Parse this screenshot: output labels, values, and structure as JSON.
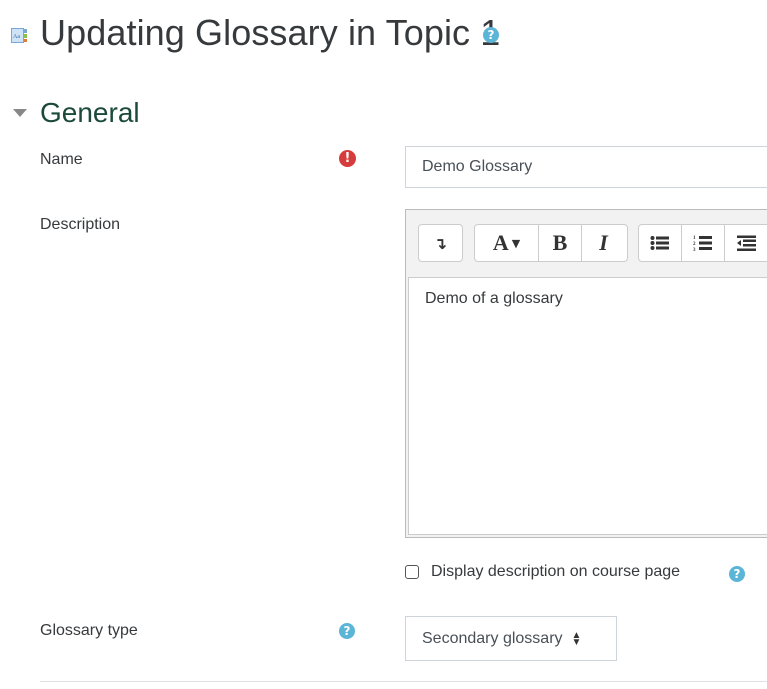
{
  "header": {
    "icon": "glossary-icon",
    "title": "Updating Glossary in Topic 1",
    "help_icon": "help-question-icon"
  },
  "section": {
    "caret_icon": "caret-down-icon",
    "title": "General"
  },
  "form": {
    "name": {
      "label": "Name",
      "required_icon": "exclamation-circle-icon",
      "value": "Demo Glossary"
    },
    "description": {
      "label": "Description",
      "toolbar": [
        {
          "name": "toolbar-toggle",
          "glyph": "↴"
        },
        {
          "name": "font-style",
          "glyph": "A▾"
        },
        {
          "name": "bold",
          "glyph": "B"
        },
        {
          "name": "italic",
          "glyph": "I"
        },
        {
          "name": "unordered-list",
          "glyph": "☰"
        },
        {
          "name": "ordered-list",
          "glyph": "☰"
        },
        {
          "name": "outdent",
          "glyph": "☰"
        }
      ],
      "content": "Demo of a glossary"
    },
    "display_description": {
      "label": "Display description on course page",
      "checked": false
    },
    "glossary_type": {
      "label": "Glossary type",
      "selected": "Secondary glossary"
    }
  },
  "colors": {
    "help_icon": "#5bb5d6",
    "required_icon": "#d63c3c",
    "section_title": "#1c4a3a"
  }
}
